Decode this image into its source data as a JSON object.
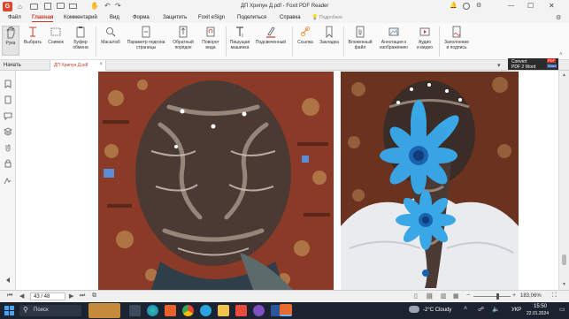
{
  "window": {
    "title": "ДП Хрипун Д.pdf - Foxit PDF Reader",
    "search_placeholder": "Подробнее",
    "minimize": "—",
    "maximize": "☐",
    "close": "✕"
  },
  "menu": {
    "items": [
      "Файл",
      "Главная",
      "Комментарий",
      "Вид",
      "Форма",
      "Защитить",
      "Foxit eSign",
      "Поделиться",
      "Справка"
    ],
    "active": "Главная"
  },
  "ribbon": {
    "hand": "Рука",
    "select": "Выбрать",
    "snapshot": "Снимок",
    "clipboard_l1": "Буфер",
    "clipboard_l2": "обмена",
    "zoom": "Масштаб",
    "pagefit_l1": "Параметр подгона",
    "pagefit_l2": "страницы",
    "reverse_l1": "Обратный",
    "reverse_l2": "порядок",
    "rotate_l1": "Поворот",
    "rotate_l2": "вида",
    "typewriter_l1": "Пишущая",
    "typewriter_l2": "машинка",
    "highlight": "Подсвеченный",
    "link": "Ссылка",
    "bookmark": "Закладка",
    "embedded_l1": "Вложенный",
    "embedded_l2": "файл",
    "image_annot_l1": "Аннотация к",
    "image_annot_l2": "изображению",
    "audio_l1": "Аудио",
    "audio_l2": "и видео",
    "fill_l1": "Заполнение",
    "fill_l2": "и подпись"
  },
  "tabs": {
    "start": "Начать",
    "document": "ДП Хрипун Д.pdf",
    "close": "×"
  },
  "convert_badge": {
    "line1": "Convert",
    "line2": "PDF 2 Word",
    "pdf": "PDF",
    "word": "Word"
  },
  "statusbar": {
    "page": "43 / 48",
    "zoom": "183,06%",
    "plus": "+",
    "minus": "−"
  },
  "taskbar": {
    "search": "Поиск",
    "weather": "-2°C Cloudy",
    "lang": "УКР",
    "time": "15:50",
    "date": "22.01.2024"
  },
  "colors": {
    "accent": "#c8392b",
    "taskbar": "#1c2330"
  }
}
